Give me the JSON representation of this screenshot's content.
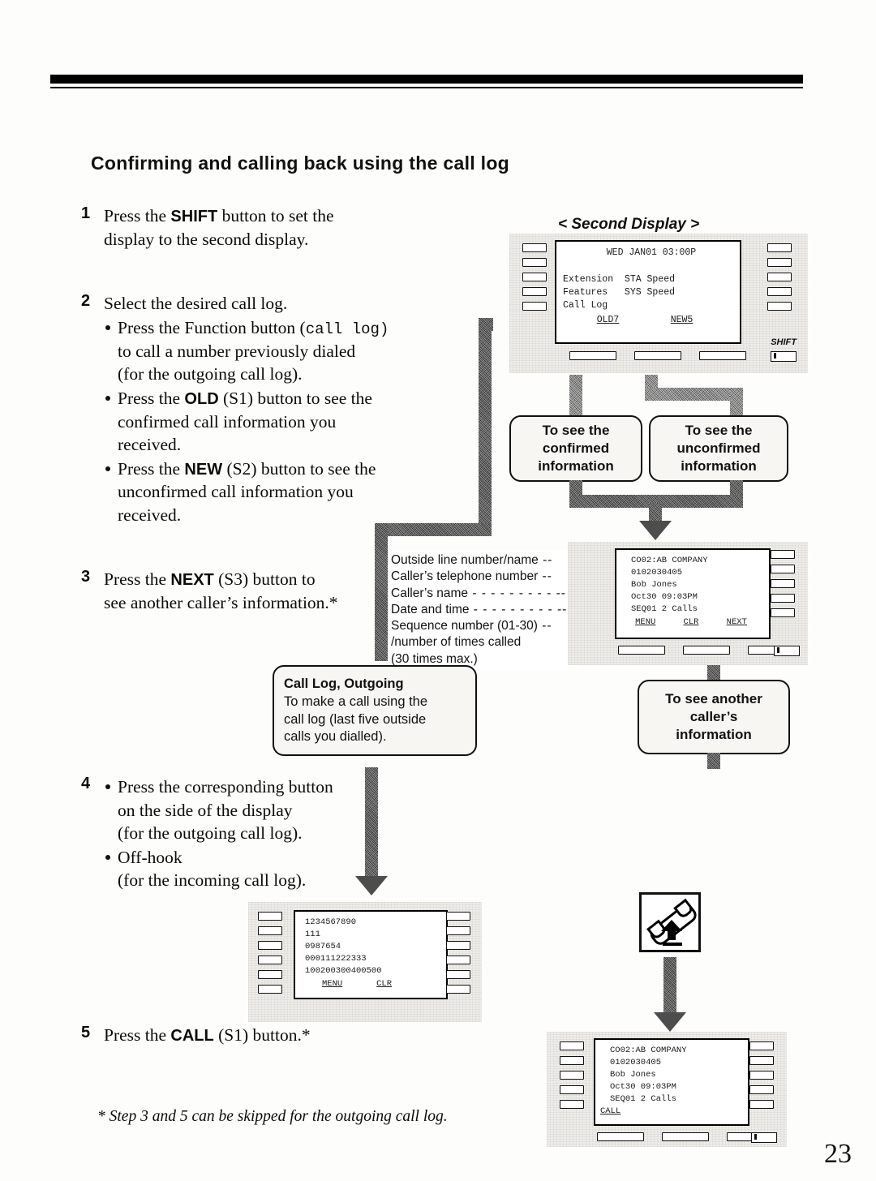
{
  "heading": "Confirming and calling back using the call log",
  "page_number": "23",
  "steps": {
    "s1": {
      "num": "1",
      "line1_a": "Press the ",
      "line1_b": "SHIFT",
      "line1_c": " button to set the",
      "line2": "display to the second display."
    },
    "s2": {
      "num": "2",
      "lead": "Select the desired call log.",
      "b1_a": "Press the Function button (",
      "b1_mono": "call log",
      "b1_b": ")",
      "b1_c": "to call a number previously dialed",
      "b1_d": "(for the outgoing call log).",
      "b2_a": "Press the ",
      "b2_b": "OLD",
      "b2_c": " (S1) button to see the",
      "b2_d": "confirmed call information you",
      "b2_e": "received.",
      "b3_a": "Press the ",
      "b3_b": "NEW",
      "b3_c": " (S2) button to see the",
      "b3_d": "unconfirmed call information you",
      "b3_e": "received."
    },
    "s3": {
      "num": "3",
      "line1_a": "Press the ",
      "line1_b": "NEXT",
      "line1_c": " (S3) button to",
      "line2": "see another caller’s information.*"
    },
    "s4": {
      "num": "4",
      "b1_1": "Press the corresponding button",
      "b1_2": "on the side of the display",
      "b1_3": "(for the outgoing call log).",
      "b2_1": "Off-hook",
      "b2_2": "(for the incoming call log)."
    },
    "s5": {
      "num": "5",
      "line1_a": "Press the ",
      "line1_b": "CALL",
      "line1_c": " (S1) button.*"
    }
  },
  "footnote": "* Step 3 and 5 can be skipped for the outgoing call log.",
  "second_display": {
    "label": "< Second Display >",
    "lines": [
      "WED JAN01 03:00P",
      "",
      "Extension  STA Speed",
      "Features   SYS Speed",
      "Call Log"
    ],
    "softkeys": [
      "OLD7",
      "NEW5"
    ],
    "shift_label": "SHIFT"
  },
  "call_detail_display": {
    "lines": [
      "CO02:AB COMPANY",
      "0102030405",
      "Bob Jones",
      "Oct30 09:03PM",
      "SEQ01 2 Calls"
    ],
    "softkeys": [
      "MENU",
      "CLR",
      "NEXT"
    ]
  },
  "outgoing_log_display": {
    "lines": [
      "1234567890",
      "111",
      "0987654",
      "000111222333",
      "100200300400500"
    ],
    "softkeys": [
      "MENU",
      "CLR"
    ]
  },
  "final_display": {
    "lines": [
      "CO02:AB COMPANY",
      "0102030405",
      "Bob Jones",
      "Oct30 09:03PM",
      "SEQ01 2 Calls"
    ],
    "softkeys": [
      "CALL"
    ]
  },
  "callouts": {
    "confirmed": [
      "To see the",
      "confirmed",
      "information"
    ],
    "unconfirmed": [
      "To see the",
      "unconfirmed",
      "information"
    ],
    "another_caller": [
      "To see another",
      "caller’s",
      "information"
    ],
    "outgoing": {
      "title": "Call Log, Outgoing",
      "l1": "To make a call using the",
      "l2": "call log (last five outside",
      "l3": "calls you dialled)."
    }
  },
  "annotations": {
    "r1": "Outside line number/name",
    "r2": "Caller’s telephone number",
    "r3": "Caller’s name",
    "r4": "Date and time",
    "r5": "Sequence number (01-30)",
    "r6": "/number of times called",
    "r7": "(30 times max.)",
    "d1": " -- ",
    "d2": " -- ",
    "d3": " - - - - - - - - - -- ",
    "d4": " - - - - - - - - - -- ",
    "d5": " -- "
  }
}
